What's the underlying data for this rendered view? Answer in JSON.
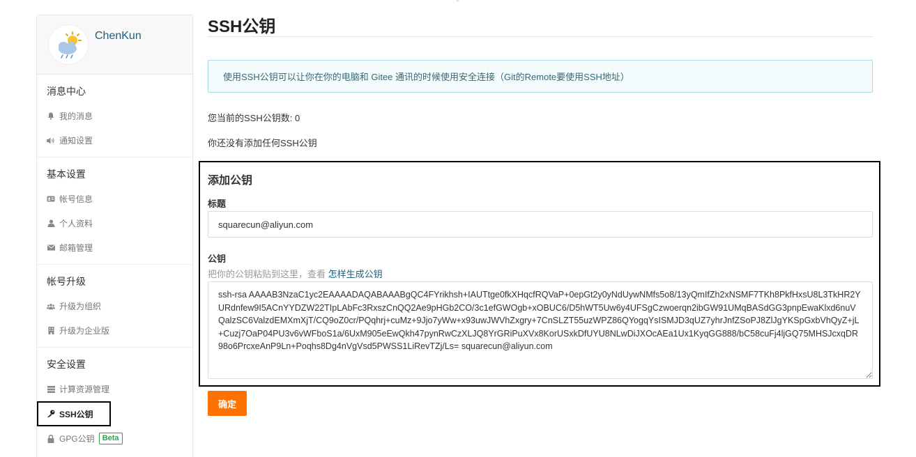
{
  "sidebar": {
    "username": "ChenKun",
    "sections": [
      {
        "title": "消息中心",
        "items": [
          {
            "icon": "bell-icon",
            "label": "我的消息"
          },
          {
            "icon": "speaker-icon",
            "label": "通知设置"
          }
        ]
      },
      {
        "title": "基本设置",
        "items": [
          {
            "icon": "id-card-icon",
            "label": "帐号信息"
          },
          {
            "icon": "user-icon",
            "label": "个人资料"
          },
          {
            "icon": "envelope-icon",
            "label": "邮箱管理"
          }
        ]
      },
      {
        "title": "帐号升级",
        "items": [
          {
            "icon": "group-icon",
            "label": "升级为组织"
          },
          {
            "icon": "building-icon",
            "label": "升级为企业版"
          }
        ]
      },
      {
        "title": "安全设置",
        "items": [
          {
            "icon": "server-icon",
            "label": "计算资源管理"
          },
          {
            "icon": "key-icon",
            "label": "SSH公钥",
            "active": true
          },
          {
            "icon": "lock-icon",
            "label": "GPG公钥",
            "badge": "Beta"
          }
        ]
      }
    ]
  },
  "main": {
    "title": "SSH公钥",
    "info": "使用SSH公钥可以让你在你的电脑和 Gitee 通讯的时候使用安全连接（Git的Remote要使用SSH地址）",
    "count_text": "您当前的SSH公钥数: 0",
    "no_key_text": "你还没有添加任何SSH公钥",
    "form": {
      "heading": "添加公钥",
      "title_label": "标题",
      "title_value": "squarecun@aliyun.com",
      "key_label": "公钥",
      "hint_text": "把你的公钥粘贴到这里，查看 ",
      "hint_link": "怎样生成公钥",
      "key_value": "ssh-rsa AAAAB3NzaC1yc2EAAAADAQABAAABgQC4FYrikhsh+IAUTtge0fkXHqcfRQVaP+0epGt2y0yNdUywNMfs5o8/13yQmIfZh2xNSMF7TKh8PkfHxsU8L3TkHR2YURdnfew9I5ACnYYDZW22TIpLAbFc3RxszCnQQ2Ae9pHGb2CO/3c1efGWOgb+xOBUC6/D5hWT5Uw6y4UFSgCzwoerqn2ibGW91UMqBASdGG3pnpEwaKlxd6nuVQalzSC6ValzdEMXmXjT/CQ9oZ0cr/PQqhrj+cuMz+9Jjo7yWw+x93uwJWVhZxgry+7CnSLZT55uzWPZ86QYogqYsISMJD3qUZ7yhrJnfZSoPJ8ZlJgYKSpGxbVhQyZ+jL+Cuzj7OaP04PU3v6vWFboS1a/6UxM905eEwQkh47pynRwCzXLJQ8YrGRiPuXVx8KorUSxkDfUYU8NLwDiJXOcAEa1Ux1KyqGG888/bC58cuFj4ljGQ75MHSJcxqDR98o6PrcxeAnP9Ln+Poqhs8Dg4nVgVsd5PWSS1LiRevTZj/Ls= squarecun@aliyun.com",
      "submit_label": "确定"
    }
  }
}
